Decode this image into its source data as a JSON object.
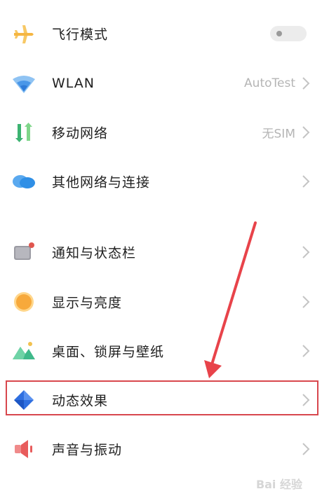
{
  "settings": {
    "items": [
      {
        "label": "飞行模式",
        "icon": "airplane-icon",
        "toggle": "off"
      },
      {
        "label": "WLAN",
        "icon": "wifi-icon",
        "value": "AutoTest"
      },
      {
        "label": "移动网络",
        "icon": "mobile-network-icon",
        "value": "无SIM"
      },
      {
        "label": "其他网络与连接",
        "icon": "cloud-connection-icon"
      },
      {
        "label": "通知与状态栏",
        "icon": "notification-icon"
      },
      {
        "label": "显示与亮度",
        "icon": "brightness-icon"
      },
      {
        "label": "桌面、锁屏与壁纸",
        "icon": "wallpaper-icon"
      },
      {
        "label": "动态效果",
        "icon": "motion-effects-icon",
        "highlighted": true
      },
      {
        "label": "声音与振动",
        "icon": "sound-icon"
      }
    ]
  },
  "annotation": {
    "color": "#d8474d"
  },
  "watermark": {
    "text": "Bai 经验"
  }
}
